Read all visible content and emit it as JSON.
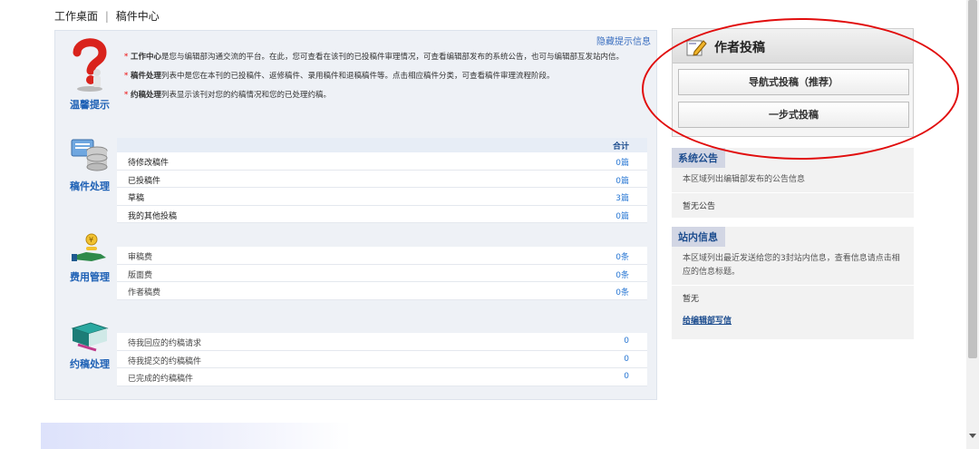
{
  "breadcrumb": {
    "home": "工作桌面",
    "separator": "|",
    "current": "稿件中心"
  },
  "tips": {
    "hide_link": "隐藏提示信息",
    "label": "温馨提示",
    "items": [
      {
        "star": "*",
        "term": "工作中心",
        "text": "是您与编辑部沟通交流的平台。在此，您可查看在该刊的已投稿件审理情况，可查看编辑部发布的系统公告，也可与编辑部互发站内信。"
      },
      {
        "star": "*",
        "term": "稿件处理",
        "text": "列表中是您在本刊的已投稿件、返修稿件、录用稿件和退稿稿件等。点击相应稿件分类，可查看稿件审理流程阶段。"
      },
      {
        "star": "*",
        "term": "约稿处理",
        "text": "列表显示该刊对您的约稿情况和您的已处理约稿。"
      }
    ]
  },
  "manuscripts": {
    "label": "稿件处理",
    "total_header": "合计",
    "rows": [
      {
        "name": "待修改稿件",
        "count": "0篇"
      },
      {
        "name": "已投稿件",
        "count": "0篇"
      },
      {
        "name": "草稿",
        "count": "3篇"
      },
      {
        "name": "我的其他投稿",
        "count": "0篇"
      }
    ]
  },
  "fees": {
    "label": "费用管理",
    "rows": [
      {
        "name": "审稿费",
        "count": "0条"
      },
      {
        "name": "版面费",
        "count": "0条"
      },
      {
        "name": "作者稿费",
        "count": "0条"
      }
    ]
  },
  "invitations": {
    "label": "约稿处理",
    "rows": [
      {
        "name": "待我回应的约稿请求",
        "count": "0"
      },
      {
        "name": "待我提交的约稿稿件",
        "count": "0"
      },
      {
        "name": "已完成的约稿稿件",
        "count": "0"
      }
    ]
  },
  "author_submit": {
    "title": "作者投稿",
    "guided_button": "导航式投稿（推荐）",
    "onestep_button": "一步式投稿"
  },
  "announcements": {
    "tab": "系统公告",
    "desc": "本区域列出编辑部发布的公告信息",
    "empty": "暂无公告"
  },
  "messages": {
    "tab": "站内信息",
    "desc": "本区域列出最近发送给您的3封站内信息，查看信息请点击相应的信息标题。",
    "empty": "暂无",
    "write_link": "给编辑部写信"
  },
  "colors": {
    "accent": "#1d60b5",
    "link": "#2a78d4",
    "annotation": "#e10d0d",
    "star": "#ee0000"
  },
  "icons": [
    "question-mark-icon",
    "database-icon",
    "money-icon",
    "book-icon",
    "edit-icon"
  ]
}
